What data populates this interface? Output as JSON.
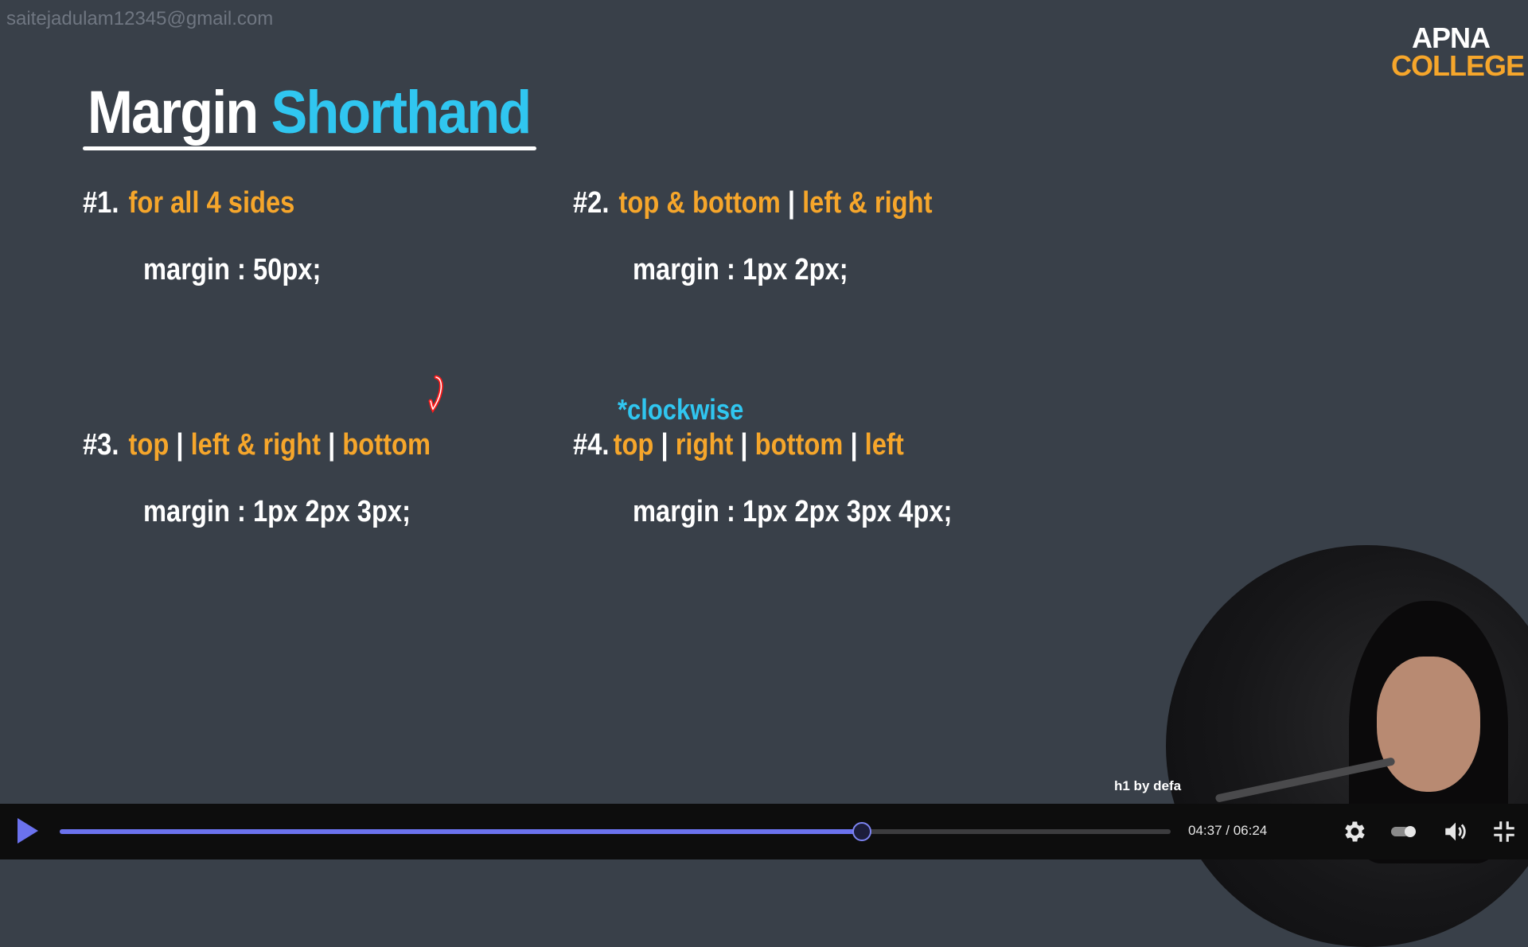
{
  "watermark": "saitejadulam12345@gmail.com",
  "logo": {
    "line1": "APNA",
    "line2": "COLLEGE"
  },
  "slide": {
    "title_part1": "Margin",
    "title_part2": "Shorthand",
    "sections": [
      {
        "number": "#1.",
        "parts": [
          "for all 4 sides"
        ],
        "code": "margin : 50px;"
      },
      {
        "number": "#2.",
        "parts": [
          "top  & bottom",
          "left & right"
        ],
        "code": "margin : 1px 2px;"
      },
      {
        "number": "#3.",
        "parts": [
          "top",
          "left  & right",
          "bottom"
        ],
        "code": "margin : 1px 2px 3px;"
      },
      {
        "number": "#4.",
        "parts": [
          "top",
          "right",
          "bottom",
          "left"
        ],
        "code": "margin : 1px 2px 3px 4px;"
      }
    ],
    "separator": "|",
    "note": "*clockwise"
  },
  "webcam_caption": "h1 by defa",
  "player": {
    "current_time": "04:37",
    "duration": "06:24",
    "time_display": "04:37 / 06:24",
    "progress": 0.721
  },
  "colors": {
    "background": "#394049",
    "accent_orange": "#f6a62b",
    "accent_cyan": "#30c6f0",
    "player_accent": "#6b72ee"
  },
  "icons": [
    "play-icon",
    "settings-icon",
    "speed-icon",
    "volume-icon",
    "exit-fullscreen-icon"
  ]
}
